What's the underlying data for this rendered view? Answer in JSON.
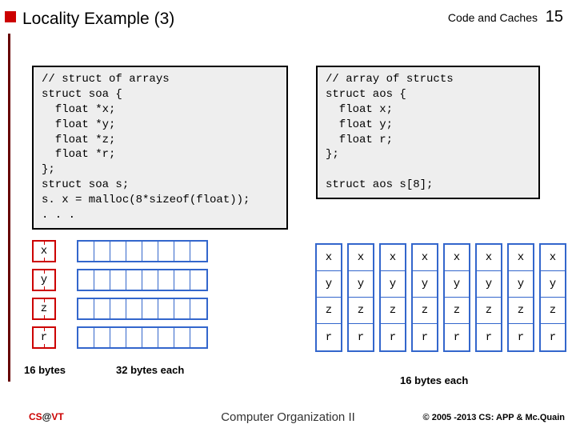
{
  "header": {
    "title": "Locality Example (3)",
    "section": "Code and Caches",
    "page": "15"
  },
  "code": {
    "left": "// struct of arrays\nstruct soa {\n  float *x;\n  float *y;\n  float *z;\n  float *r;\n};\nstruct soa s;\ns. x = malloc(8*sizeof(float));\n. . .",
    "right": "// array of structs\nstruct aos {\n  float x;\n  float y;\n  float r;\n};\n\nstruct aos s[8];"
  },
  "soa": {
    "labels": [
      "x",
      "y",
      "z",
      "r"
    ],
    "cellsPerRow": 8
  },
  "aos": {
    "cols": 8,
    "labels": [
      "x",
      "y",
      "z",
      "r"
    ]
  },
  "annot": {
    "b16": "16 bytes",
    "b32": "32 bytes each",
    "b16r": "16 bytes each"
  },
  "footer": {
    "left_a": "CS",
    "left_at": "@",
    "left_b": "VT",
    "center": "Computer Organization II",
    "right": "© 2005 -2013 CS: APP & Mc.Quain"
  }
}
